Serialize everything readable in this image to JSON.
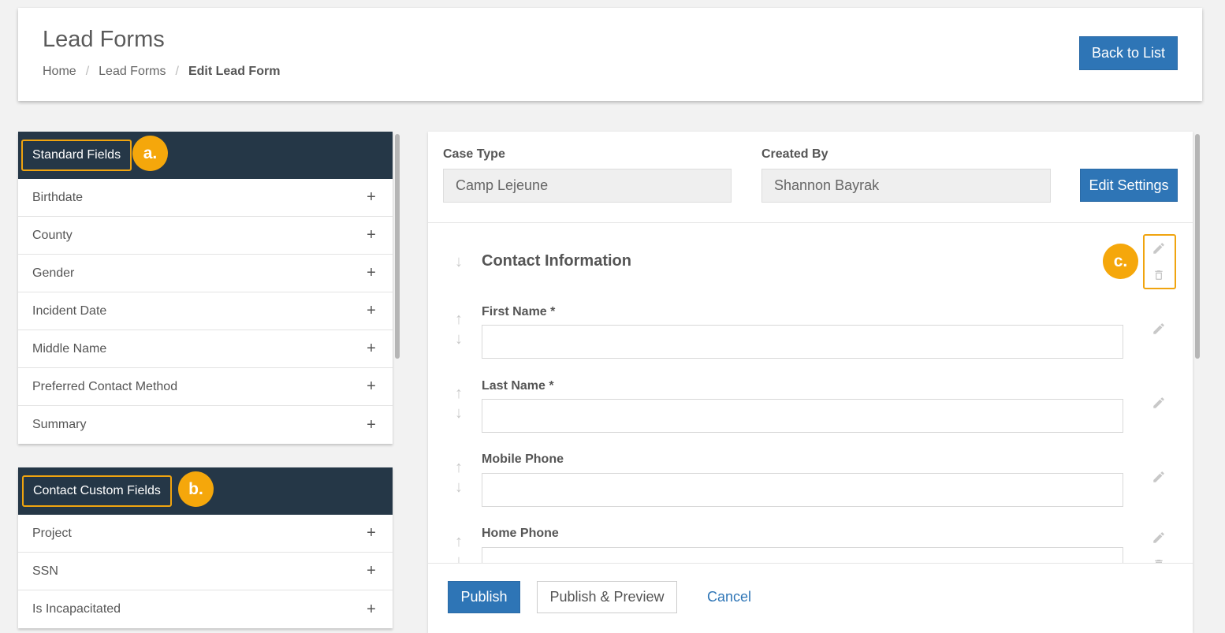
{
  "header": {
    "title": "Lead Forms",
    "breadcrumb": [
      "Home",
      "Lead Forms",
      "Edit Lead Form"
    ],
    "separator": "/",
    "back_button": "Back to List"
  },
  "standard_fields": {
    "title": "Standard Fields",
    "badge": "a.",
    "items": [
      "Birthdate",
      "County",
      "Gender",
      "Incident Date",
      "Middle Name",
      "Preferred Contact Method",
      "Summary"
    ]
  },
  "contact_custom_fields": {
    "title": "Contact Custom Fields",
    "badge": "b.",
    "items": [
      "Project",
      "SSN",
      "Is Incapacitated"
    ]
  },
  "add_symbol": "+",
  "settings": {
    "case_type_label": "Case Type",
    "case_type_value": "Camp Lejeune",
    "created_by_label": "Created By",
    "created_by_value": "Shannon Bayrak",
    "edit_button": "Edit Settings"
  },
  "form": {
    "section_title": "Contact Information",
    "section_badge": "c.",
    "fields": [
      {
        "label": "First Name *"
      },
      {
        "label": "Last Name *"
      },
      {
        "label": "Mobile Phone"
      },
      {
        "label": "Home Phone"
      }
    ]
  },
  "footer": {
    "publish": "Publish",
    "publish_preview": "Publish & Preview",
    "cancel": "Cancel"
  },
  "colors": {
    "primary": "#2e75b6",
    "panel_header": "#253747",
    "highlight": "#f5a70b"
  },
  "icons": {
    "move_up": "↑",
    "move_down": "↓"
  }
}
